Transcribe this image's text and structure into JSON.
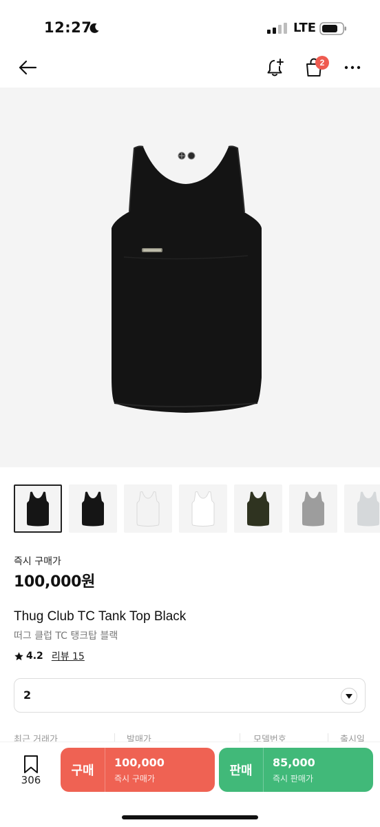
{
  "status_bar": {
    "time": "12:27",
    "network": "LTE"
  },
  "nav": {
    "cart_badge": "2",
    "icons": [
      "back-arrow-icon",
      "bell-plus-icon",
      "shopping-bag-icon",
      "more-icon"
    ]
  },
  "thumbnails": [
    {
      "color": "#151515",
      "selected": true
    },
    {
      "color": "#151515",
      "selected": false
    },
    {
      "color": "#f3f3f3",
      "selected": false
    },
    {
      "color": "#ffffff",
      "selected": false
    },
    {
      "color": "#2f3320",
      "selected": false
    },
    {
      "color": "#9d9d9d",
      "selected": false
    },
    {
      "color": "#d5d8da",
      "selected": false
    }
  ],
  "product": {
    "price_label": "즉시 구매가",
    "price": "100,000원",
    "name_en": "Thug Club TC Tank Top Black",
    "name_ko": "떠그 클럽 TC 탱크탑 블랙",
    "rating": "4.2",
    "review_label": "리뷰 15"
  },
  "size_select": {
    "value": "2"
  },
  "info_row": [
    "최근 거래가",
    "발매가",
    "모델번호",
    "출시일"
  ],
  "bottom_bar": {
    "bookmark_count": "306",
    "buy": {
      "kind": "구매",
      "price": "100,000",
      "sub": "즉시 구매가"
    },
    "sell": {
      "kind": "판매",
      "price": "85,000",
      "sub": "즉시 판매가"
    }
  },
  "colors": {
    "buy": "#ef6253",
    "sell": "#41b979",
    "badge": "#ef5b50"
  }
}
